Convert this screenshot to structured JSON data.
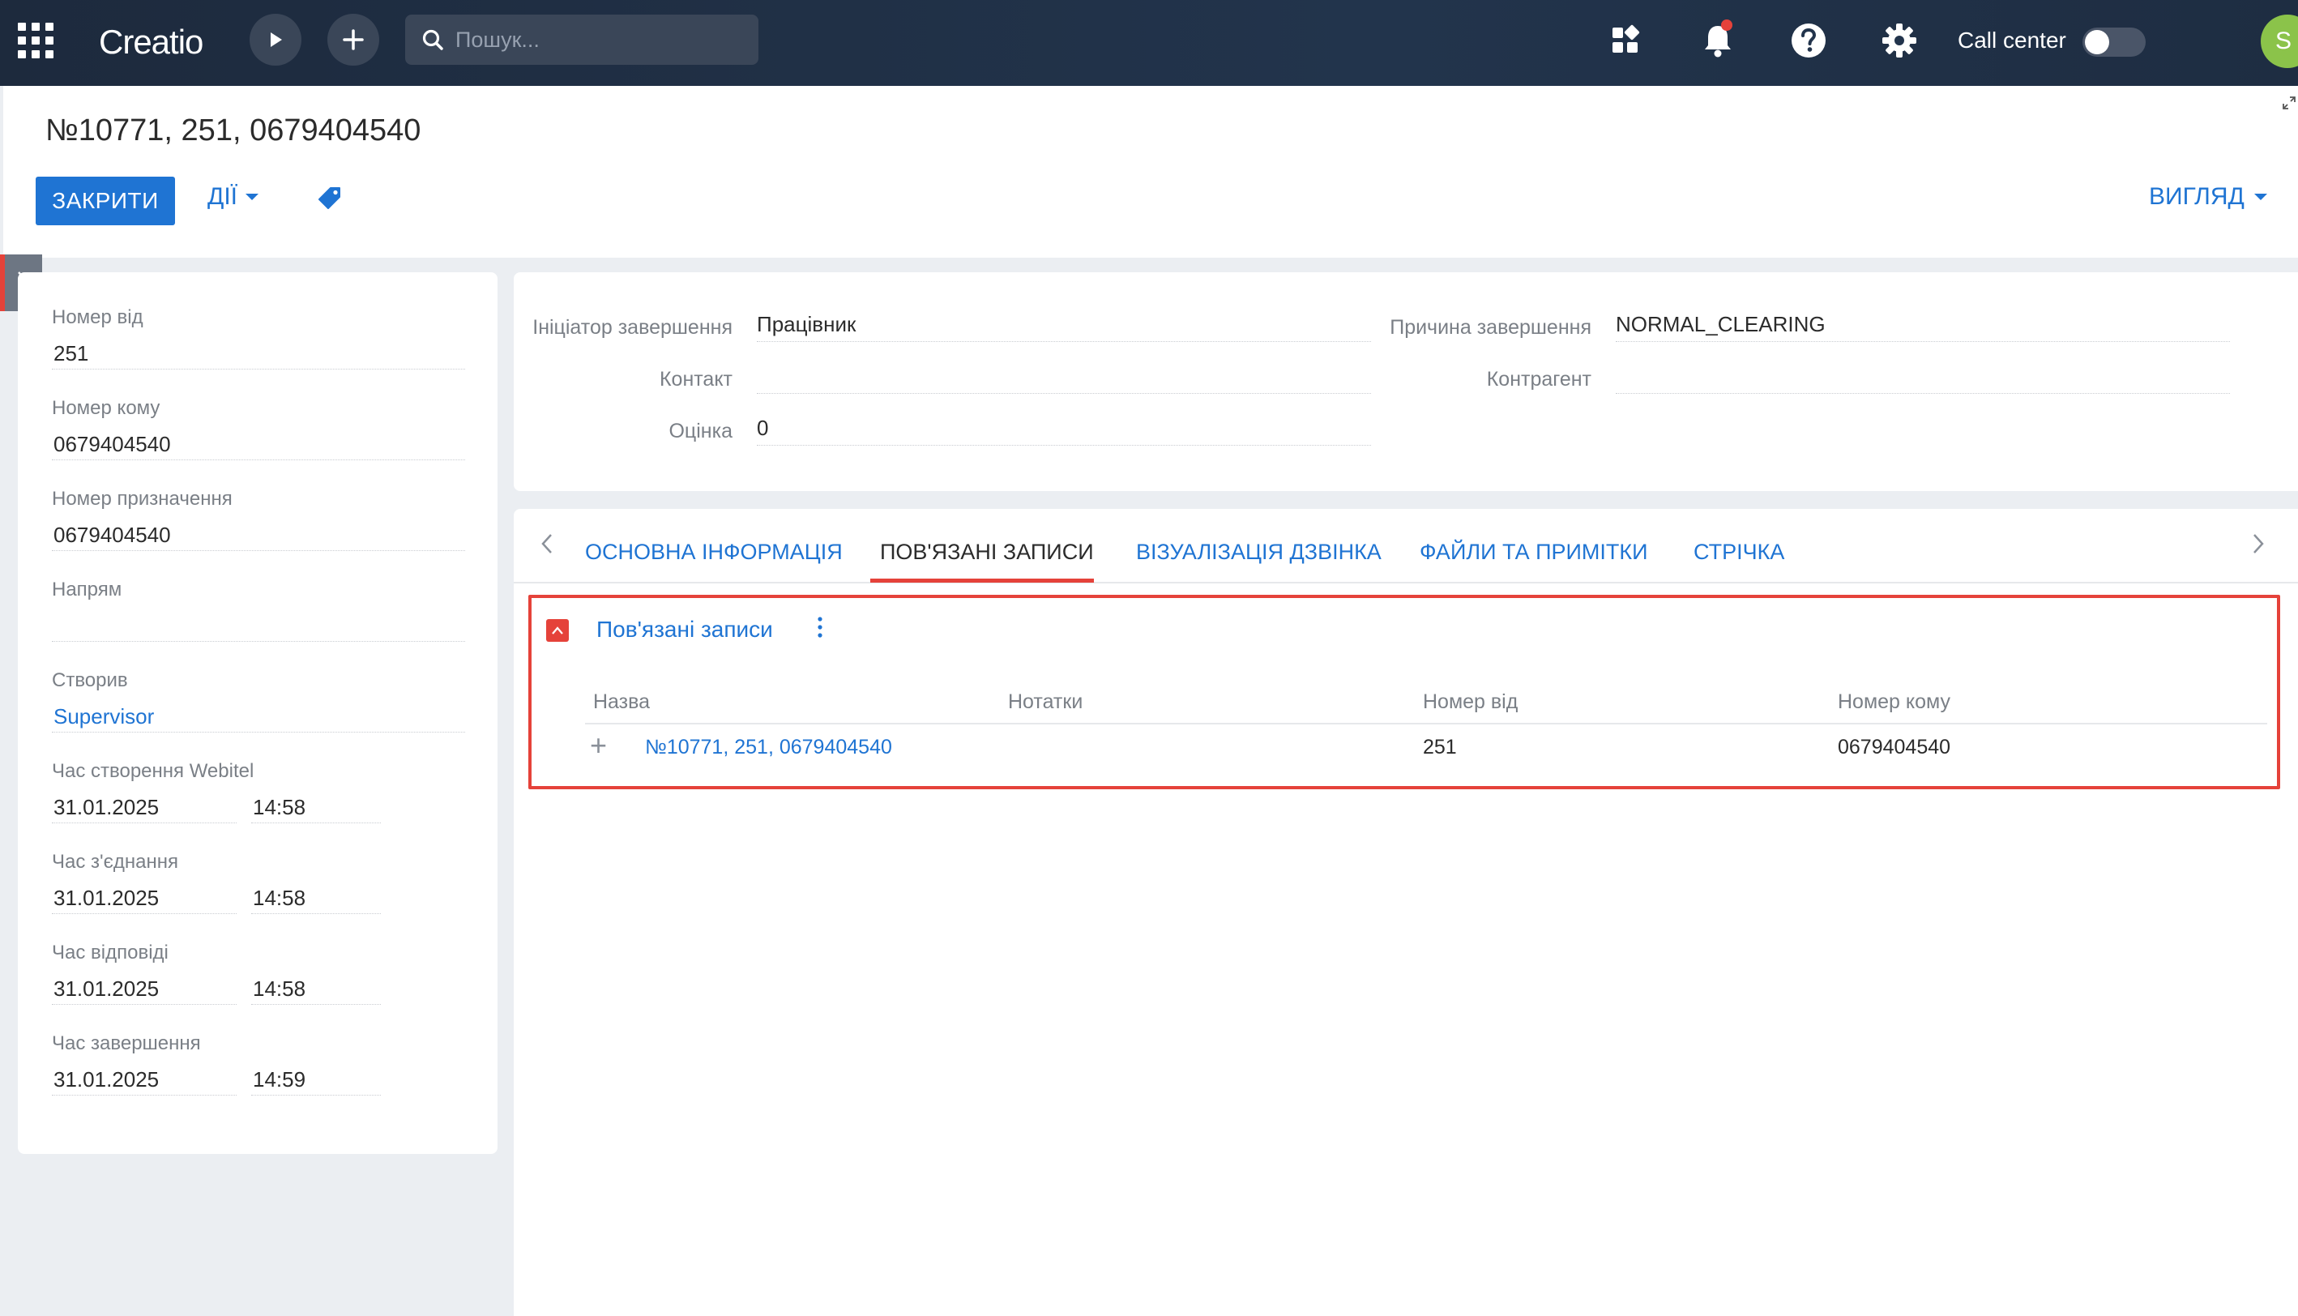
{
  "topbar": {
    "logo": "Creatio",
    "search_placeholder": "Пошук...",
    "call_center_label": "Call center",
    "avatar_initial": "S"
  },
  "header": {
    "title": "№10771, 251, 0679404540",
    "close_label": "ЗАКРИТИ",
    "actions_label": "ДІЇ",
    "view_label": "ВИГЛЯД"
  },
  "left_panel": {
    "number_from_label": "Номер від",
    "number_from": "251",
    "number_to_label": "Номер кому",
    "number_to": "0679404540",
    "destination_label": "Номер призначення",
    "destination": "0679404540",
    "direction_label": "Напрям",
    "direction": "",
    "created_by_label": "Створив",
    "created_by": "Supervisor",
    "created_time_label": "Час створення Webitel",
    "created_date": "31.01.2025",
    "created_time": "14:58",
    "connect_time_label": "Час з'єднання",
    "connect_date": "31.01.2025",
    "connect_time": "14:58",
    "answer_time_label": "Час відповіді",
    "answer_date": "31.01.2025",
    "answer_time": "14:58",
    "end_time_label": "Час завершення",
    "end_date": "31.01.2025",
    "end_time": "14:59"
  },
  "info_panel": {
    "initiator_label": "Ініціатор завершення",
    "initiator": "Працівник",
    "reason_label": "Причина завершення",
    "reason": "NORMAL_CLEARING",
    "contact_label": "Контакт",
    "contact": "",
    "counterparty_label": "Контрагент",
    "counterparty": "",
    "rating_label": "Оцінка",
    "rating": "0"
  },
  "tabs": [
    {
      "label": "ОСНОВНА ІНФОРМАЦІЯ"
    },
    {
      "label": "ПОВ'ЯЗАНІ ЗАПИСИ"
    },
    {
      "label": "ВІЗУАЛІЗАЦІЯ ДЗВІНКА"
    },
    {
      "label": "ФАЙЛИ ТА ПРИМІТКИ"
    },
    {
      "label": "СТРІЧКА"
    }
  ],
  "active_tab": "ПОВ'ЯЗАНІ ЗАПИСИ",
  "related": {
    "title": "Пов'язані записи",
    "columns": [
      "Назва",
      "Нотатки",
      "Номер від",
      "Номер кому"
    ],
    "rows": [
      {
        "name": "№10771, 251, 0679404540",
        "notes": "",
        "from": "251",
        "to": "0679404540"
      }
    ]
  },
  "colors": {
    "accent": "#1f74d3",
    "highlight": "#e5423a",
    "topbar": "#1d2a3d",
    "avatar": "#8bc34a"
  }
}
